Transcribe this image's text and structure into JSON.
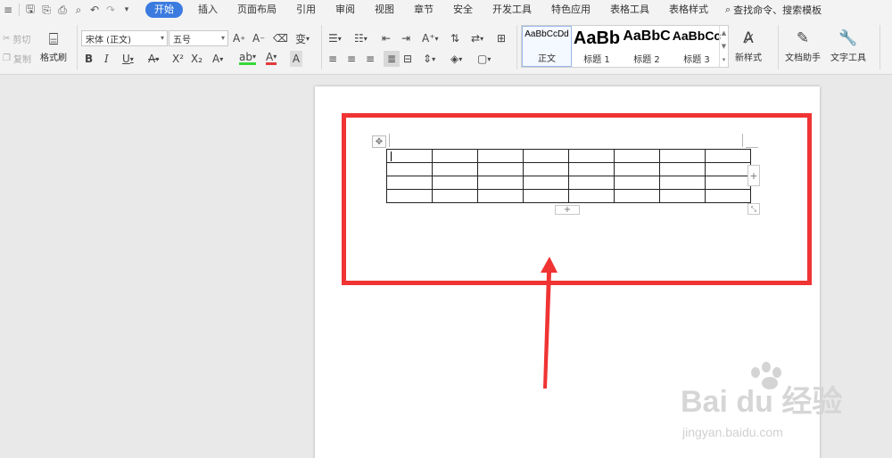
{
  "menubar": {
    "tabs": [
      "开始",
      "插入",
      "页面布局",
      "引用",
      "审阅",
      "视图",
      "章节",
      "安全",
      "开发工具",
      "特色应用",
      "表格工具",
      "表格样式"
    ],
    "active_tab": "开始",
    "search_label": "查找命令、搜索模板"
  },
  "ribbon": {
    "clipboard": {
      "cut": "剪切",
      "copy": "复制",
      "format_painter": "格式刷"
    },
    "font": {
      "name": "宋体 (正文)",
      "size": "五号"
    },
    "styles": [
      {
        "preview": "AaBbCcDd",
        "name": "正文"
      },
      {
        "preview": "AaBb",
        "name": "标题 1"
      },
      {
        "preview": "AaBbC",
        "name": "标题 2"
      },
      {
        "preview": "AaBbCc",
        "name": "标题 3"
      }
    ],
    "new_style": "新样式",
    "doc_assistant": "文档助手",
    "text_tools": "文字工具"
  },
  "document": {
    "table": {
      "rows": 4,
      "cols": 8
    }
  },
  "watermark": {
    "brand": "Bai du 经验",
    "url": "jingyan.baidu.com"
  },
  "colors": {
    "accent": "#3b7be0",
    "highlight": "#f03333",
    "font_color_bar": "#e23b3b"
  }
}
